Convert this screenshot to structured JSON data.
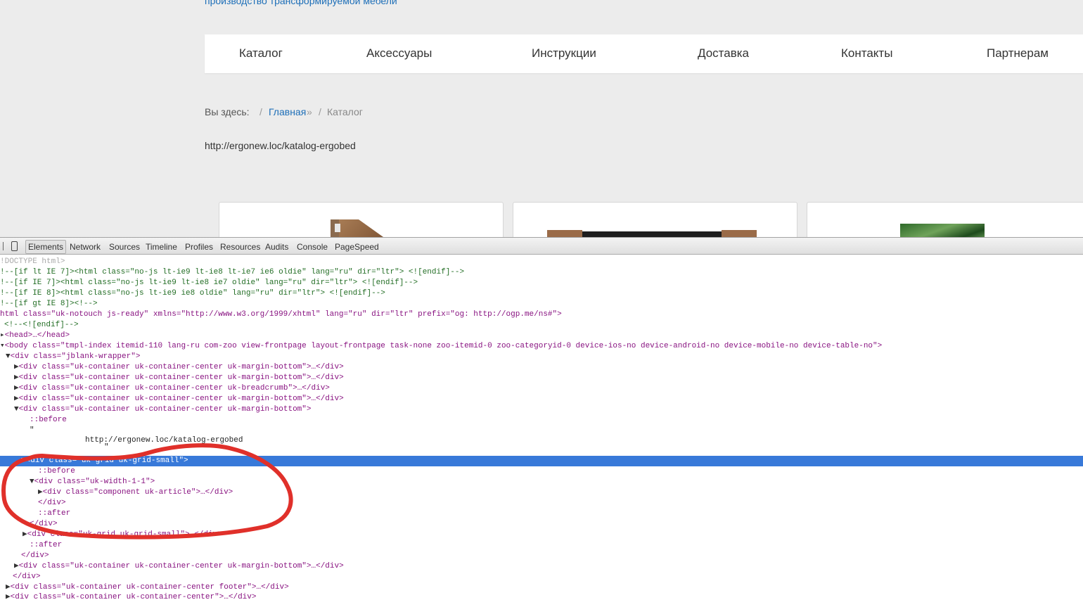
{
  "site": {
    "tagline": "производство трансформируемой мебели",
    "nav": [
      "Каталог",
      "Аксессуары",
      "Инструкции",
      "Доставка",
      "Контакты",
      "Партнерам"
    ],
    "breadcrumb": {
      "label": "Вы здесь:",
      "separator": "/",
      "home": "Главная",
      "arrow": "»",
      "current": "Каталог"
    },
    "url_text": "http://ergonew.loc/katalog-ergobed"
  },
  "devtools": {
    "tabs": [
      "Elements",
      "Network",
      "Sources",
      "Timeline",
      "Profiles",
      "Resources",
      "Audits",
      "Console",
      "PageSpeed"
    ],
    "active_tab": "Elements",
    "tree": [
      "!DOCTYPE html>",
      "!--[if lt IE 7]><html class=\"no-js lt-ie9 lt-ie8 lt-ie7 ie6 oldie\" lang=\"ru\" dir=\"ltr\"> <![endif]-->",
      "!--[if IE 7]><html class=\"no-js lt-ie9 lt-ie8 ie7 oldie\" lang=\"ru\" dir=\"ltr\"> <![endif]-->",
      "!--[if IE 8]><html class=\"no-js lt-ie9 ie8 oldie\" lang=\"ru\" dir=\"ltr\"> <![endif]-->",
      "!--[if gt IE 8]><!-->",
      "html class=\"uk-notouch js-ready\" xmlns=\"http://www.w3.org/1999/xhtml\" lang=\"ru\" dir=\"ltr\" prefix=\"og: http://ogp.me/ns#\">",
      "<!--<![endif]-->",
      "<head>…</head>",
      "<body class=\"tmpl-index itemid-110 lang-ru com-zoo view-frontpage layout-frontpage task-none zoo-itemid-0 zoo-categoryid-0 device-ios-no device-android-no device-mobile-no device-table-no\">",
      "<div class=\"jblank-wrapper\">",
      "<div class=\"uk-container uk-container-center uk-margin-bottom\">…</div>",
      "<div class=\"uk-container uk-container-center uk-margin-bottom\">…</div>",
      "<div class=\"uk-container uk-container-center uk-breadcrumb\">…</div>",
      "<div class=\"uk-container uk-container-center uk-margin-bottom\">…</div>",
      "<div class=\"uk-container uk-container-center uk-margin-bottom\">",
      "::before",
      "\"",
      "http://ergonew.loc/katalog-ergobed",
      "\"",
      "<div class=\"uk-grid uk-grid-small\">",
      "::before",
      "<div class=\"uk-width-1-1\">",
      "<div class=\"component uk-article\">…</div>",
      "</div>",
      "::after",
      "</div>",
      "<div class=\"uk-grid uk-grid-small\">…</div>",
      "::after",
      "</div>",
      "<div class=\"uk-container uk-container-center uk-margin-bottom\">…</div>",
      "</div>",
      "<div class=\"uk-container uk-container-center footer\">…</div>",
      "<div class=\"uk-container uk-container-center\">…</div>"
    ]
  },
  "colors": {
    "page_bg": "#ececec",
    "link_blue": "#1e6fb8",
    "selection_blue": "#3879d9",
    "annotation_red": "#e0302a",
    "tag_purple": "#881280",
    "attr_brown": "#994500",
    "value_blue": "#1a1aa6"
  }
}
